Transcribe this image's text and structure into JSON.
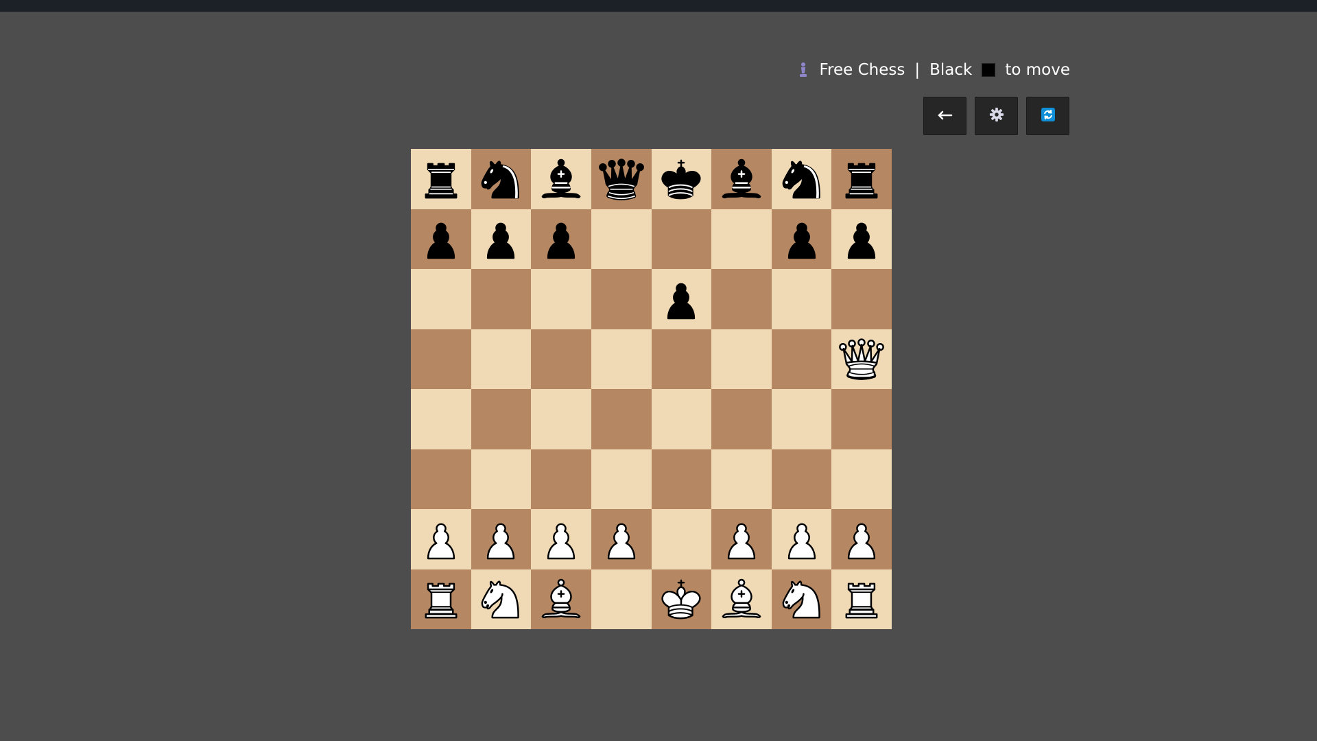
{
  "header": {
    "app_name": "Free Chess",
    "separator": "|",
    "turn_color_name": "Black",
    "turn_suffix": "to move",
    "turn_swatch_color": "#000000",
    "logo_icon": "pawn-icon"
  },
  "toolbar": {
    "buttons": [
      {
        "name": "back-button",
        "icon": "arrow-left-icon"
      },
      {
        "name": "settings-button",
        "icon": "gear-icon"
      },
      {
        "name": "flip-board-button",
        "icon": "refresh-icon"
      }
    ]
  },
  "colors": {
    "light_square": "#f0d9b5",
    "dark_square": "#b58863",
    "accent_blue": "#0f8fd8"
  },
  "board": {
    "orientation": "white-bottom",
    "ranks": [
      [
        "br",
        "bn",
        "bb",
        "bq",
        "bk",
        "bb",
        "bn",
        "br"
      ],
      [
        "bp",
        "bp",
        "bp",
        "",
        "",
        "",
        "bp",
        "bp"
      ],
      [
        "",
        "",
        "",
        "",
        "bp",
        "",
        "",
        ""
      ],
      [
        "",
        "",
        "",
        "",
        "",
        "",
        "",
        "wq"
      ],
      [
        "",
        "",
        "",
        "",
        "",
        "",
        "",
        ""
      ],
      [
        "",
        "",
        "",
        "",
        "",
        "",
        "",
        ""
      ],
      [
        "wp",
        "wp",
        "wp",
        "wp",
        "",
        "wp",
        "wp",
        "wp"
      ],
      [
        "wr",
        "wn",
        "wb",
        "",
        "wk",
        "wb",
        "wn",
        "wr"
      ]
    ]
  }
}
